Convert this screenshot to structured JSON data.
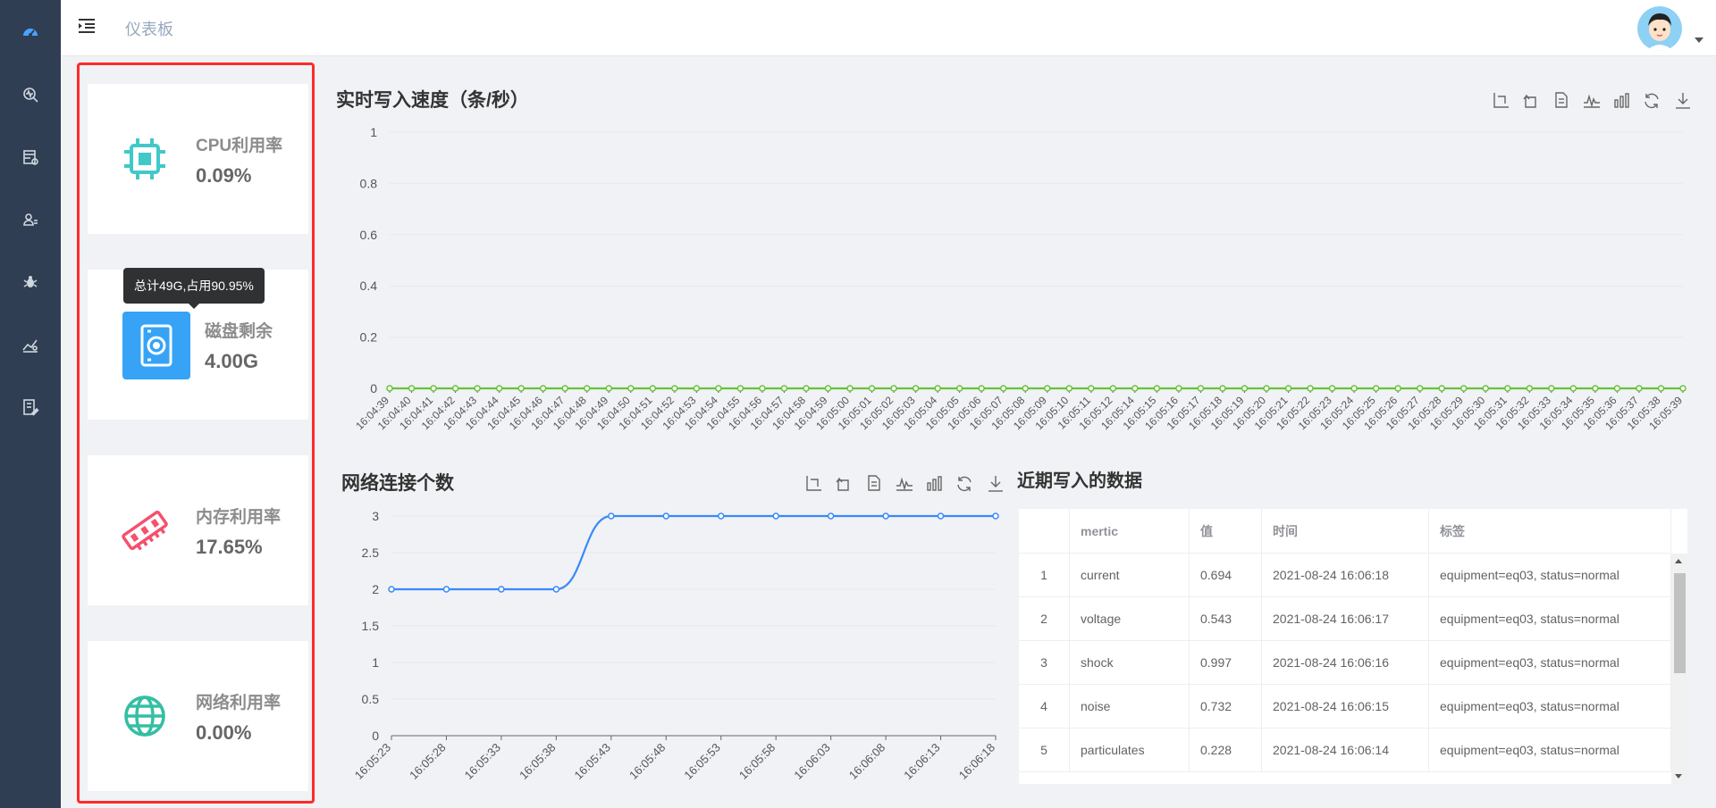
{
  "header": {
    "breadcrumb": "仪表板"
  },
  "sidebar": {
    "items": [
      {
        "icon": "dashboard-icon"
      },
      {
        "icon": "monitor-search-icon"
      },
      {
        "icon": "database-settings-icon"
      },
      {
        "icon": "user-list-icon"
      },
      {
        "icon": "bug-icon"
      },
      {
        "icon": "analytics-icon"
      },
      {
        "icon": "document-edit-icon"
      }
    ]
  },
  "cards": [
    {
      "label": "CPU利用率",
      "value": "0.09%",
      "icon": "cpu-icon",
      "color": "#40c9c6"
    },
    {
      "label": "磁盘剩余",
      "value": "4.00G",
      "icon": "disk-icon",
      "color": "#36a3f7",
      "tooltip": "总计49G,占用90.95%"
    },
    {
      "label": "内存利用率",
      "value": "17.65%",
      "icon": "memory-icon",
      "color": "#f4516c"
    },
    {
      "label": "网络利用率",
      "value": "0.00%",
      "icon": "globe-icon",
      "color": "#34bfa3"
    }
  ],
  "charts": {
    "write_speed": {
      "title": "实时写入速度（条/秒）"
    },
    "network": {
      "title": "网络连接个数"
    }
  },
  "chart_data": [
    {
      "type": "line",
      "title": "实时写入速度（条/秒）",
      "ylim": [
        0,
        1
      ],
      "yticks": [
        "0",
        "0.2",
        "0.4",
        "0.6",
        "0.8",
        "1"
      ],
      "x": [
        "16:04:39",
        "16:04:40",
        "16:04:41",
        "16:04:42",
        "16:04:43",
        "16:04:44",
        "16:04:45",
        "16:04:46",
        "16:04:47",
        "16:04:48",
        "16:04:49",
        "16:04:50",
        "16:04:51",
        "16:04:52",
        "16:04:53",
        "16:04:54",
        "16:04:55",
        "16:04:56",
        "16:04:57",
        "16:04:58",
        "16:04:59",
        "16:05:00",
        "16:05:01",
        "16:05:02",
        "16:05:03",
        "16:05:04",
        "16:05:05",
        "16:05:06",
        "16:05:07",
        "16:05:08",
        "16:05:09",
        "16:05:10",
        "16:05:11",
        "16:05:12",
        "16:05:14",
        "16:05:15",
        "16:05:16",
        "16:05:17",
        "16:05:18",
        "16:05:19",
        "16:05:20",
        "16:05:21",
        "16:05:22",
        "16:05:23",
        "16:05:24",
        "16:05:25",
        "16:05:26",
        "16:05:27",
        "16:05:28",
        "16:05:29",
        "16:05:30",
        "16:05:31",
        "16:05:32",
        "16:05:33",
        "16:05:34",
        "16:05:35",
        "16:05:36",
        "16:05:37",
        "16:05:38",
        "16:05:39"
      ],
      "values": [
        0,
        0,
        0,
        0,
        0,
        0,
        0,
        0,
        0,
        0,
        0,
        0,
        0,
        0,
        0,
        0,
        0,
        0,
        0,
        0,
        0,
        0,
        0,
        0,
        0,
        0,
        0,
        0,
        0,
        0,
        0,
        0,
        0,
        0,
        0,
        0,
        0,
        0,
        0,
        0,
        0,
        0,
        0,
        0,
        0,
        0,
        0,
        0,
        0,
        0,
        0,
        0,
        0,
        0,
        0,
        0,
        0,
        0,
        0,
        0
      ],
      "color": "#67c23a",
      "grid": true
    },
    {
      "type": "line",
      "title": "网络连接个数",
      "ylim": [
        0,
        3
      ],
      "yticks": [
        "0",
        "0.5",
        "1",
        "1.5",
        "2",
        "2.5",
        "3"
      ],
      "x": [
        "16:05:23",
        "16:05:28",
        "16:05:33",
        "16:05:38",
        "16:05:43",
        "16:05:48",
        "16:05:53",
        "16:05:58",
        "16:06:03",
        "16:06:08",
        "16:06:13",
        "16:06:18"
      ],
      "values": [
        2,
        2,
        2,
        2,
        3,
        3,
        3,
        3,
        3,
        3,
        3,
        3
      ],
      "color": "#3888fa",
      "grid": true
    }
  ],
  "table": {
    "title": "近期写入的数据",
    "headers": [
      "",
      "mertic",
      "值",
      "时间",
      "标签"
    ],
    "rows": [
      [
        "1",
        "current",
        "0.694",
        "2021-08-24 16:06:18",
        "equipment=eq03, status=normal"
      ],
      [
        "2",
        "voltage",
        "0.543",
        "2021-08-24 16:06:17",
        "equipment=eq03, status=normal"
      ],
      [
        "3",
        "shock",
        "0.997",
        "2021-08-24 16:06:16",
        "equipment=eq03, status=normal"
      ],
      [
        "4",
        "noise",
        "0.732",
        "2021-08-24 16:06:15",
        "equipment=eq03, status=normal"
      ],
      [
        "5",
        "particulates",
        "0.228",
        "2021-08-24 16:06:14",
        "equipment=eq03, status=normal"
      ]
    ]
  },
  "toolbox": [
    "zoom-icon",
    "zoom-reset-icon",
    "data-view-icon",
    "line-chart-icon",
    "bar-chart-icon",
    "restore-icon",
    "download-icon"
  ]
}
